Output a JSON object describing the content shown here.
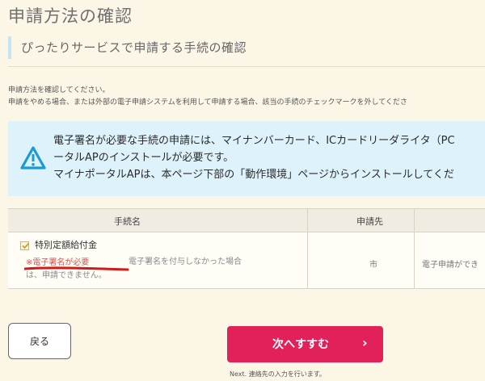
{
  "page": {
    "title": "申請方法の確認",
    "section_heading": "ぴったりサービスで申請する手続の確認"
  },
  "instructions": {
    "line1": "申請方法を確認してください。",
    "line2": "申請をやめる場合、または外部の電子申請システムを利用して申請する場合、該当の手続のチェックマークを外してくださ"
  },
  "notice": {
    "icon": "warning-icon",
    "line1": "電子署名が必要な手続の申請には、マイナンバーカード、ICカードリーダライタ（PC",
    "line2": "ータルAPのインストールが必要です。",
    "line3": "マイナポータルAPは、本ページ下部の「動作環境」ページからインストールしてくだ"
  },
  "table": {
    "headers": {
      "name": "手続名",
      "destination": "申請先",
      "method": ""
    },
    "row": {
      "checked": true,
      "name": "特別定額給付金",
      "signature_required": "※電子署名が必要",
      "signature_note_line1": "電子署名を付与しなかった場合",
      "signature_note_line2": "は、申請できません。",
      "destination": "市",
      "method": "電子申請ができ"
    }
  },
  "buttons": {
    "back": "戻る",
    "next": "次へすすむ",
    "next_chevron": "›",
    "next_note": "Next. 連絡先の入力を行います。"
  },
  "colors": {
    "background": "#fbf6e6",
    "notice_bg": "#def2fb",
    "warning_icon": "#1a9ad6",
    "primary_button": "#e2215b",
    "signature_required_text": "#d9534f",
    "annotation_underline": "#d11a1a"
  }
}
